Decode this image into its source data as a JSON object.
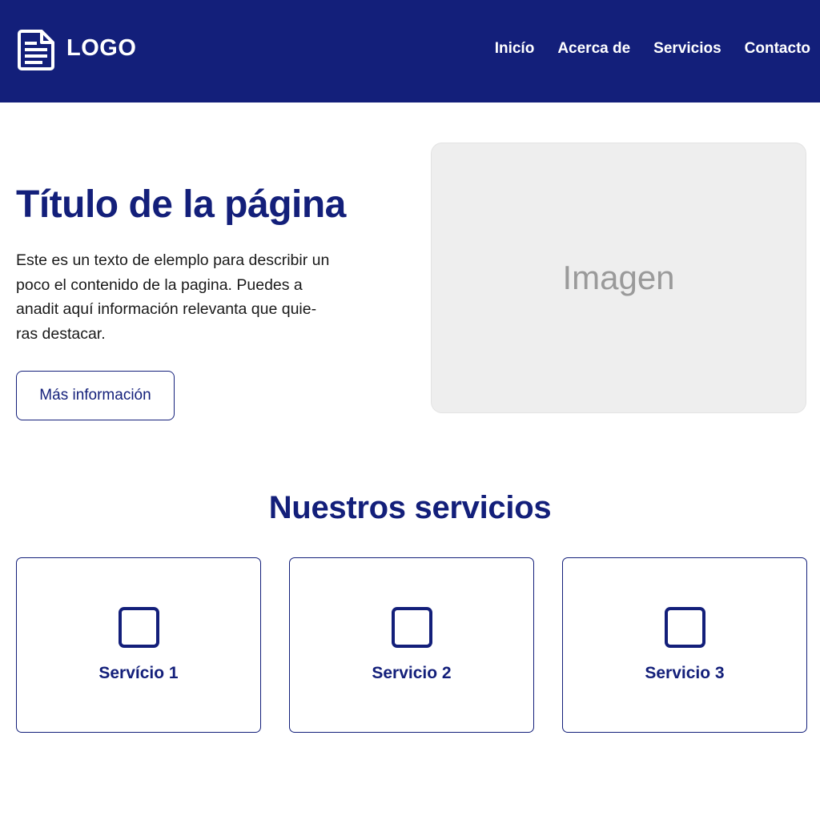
{
  "header": {
    "logo_text": "LOGO",
    "logo_icon": "document-icon",
    "background_color": "#131f7a",
    "nav": [
      {
        "label": "Inicío"
      },
      {
        "label": "Acerca de"
      },
      {
        "label": "Servicios"
      },
      {
        "label": "Contacto"
      }
    ]
  },
  "hero": {
    "title": "Título de la página",
    "description_lines": [
      "Este es un texto de elemplo para describir un",
      "poco el contenido de la pagina. Puedes a",
      "anadit aquí información relevanta que quie-",
      "ras destacar."
    ],
    "button_label": "Más información",
    "image_label": "Imagen"
  },
  "services": {
    "title": "Nuestros servicios",
    "items": [
      {
        "label": "Servício 1",
        "icon": "square-icon"
      },
      {
        "label": "Servicio 2",
        "icon": "square-icon"
      },
      {
        "label": "Servicio 3",
        "icon": "square-icon"
      }
    ]
  },
  "colors": {
    "primary": "#131f7a",
    "placeholder_bg": "#eeeeee",
    "placeholder_text": "#9a9a9a"
  }
}
